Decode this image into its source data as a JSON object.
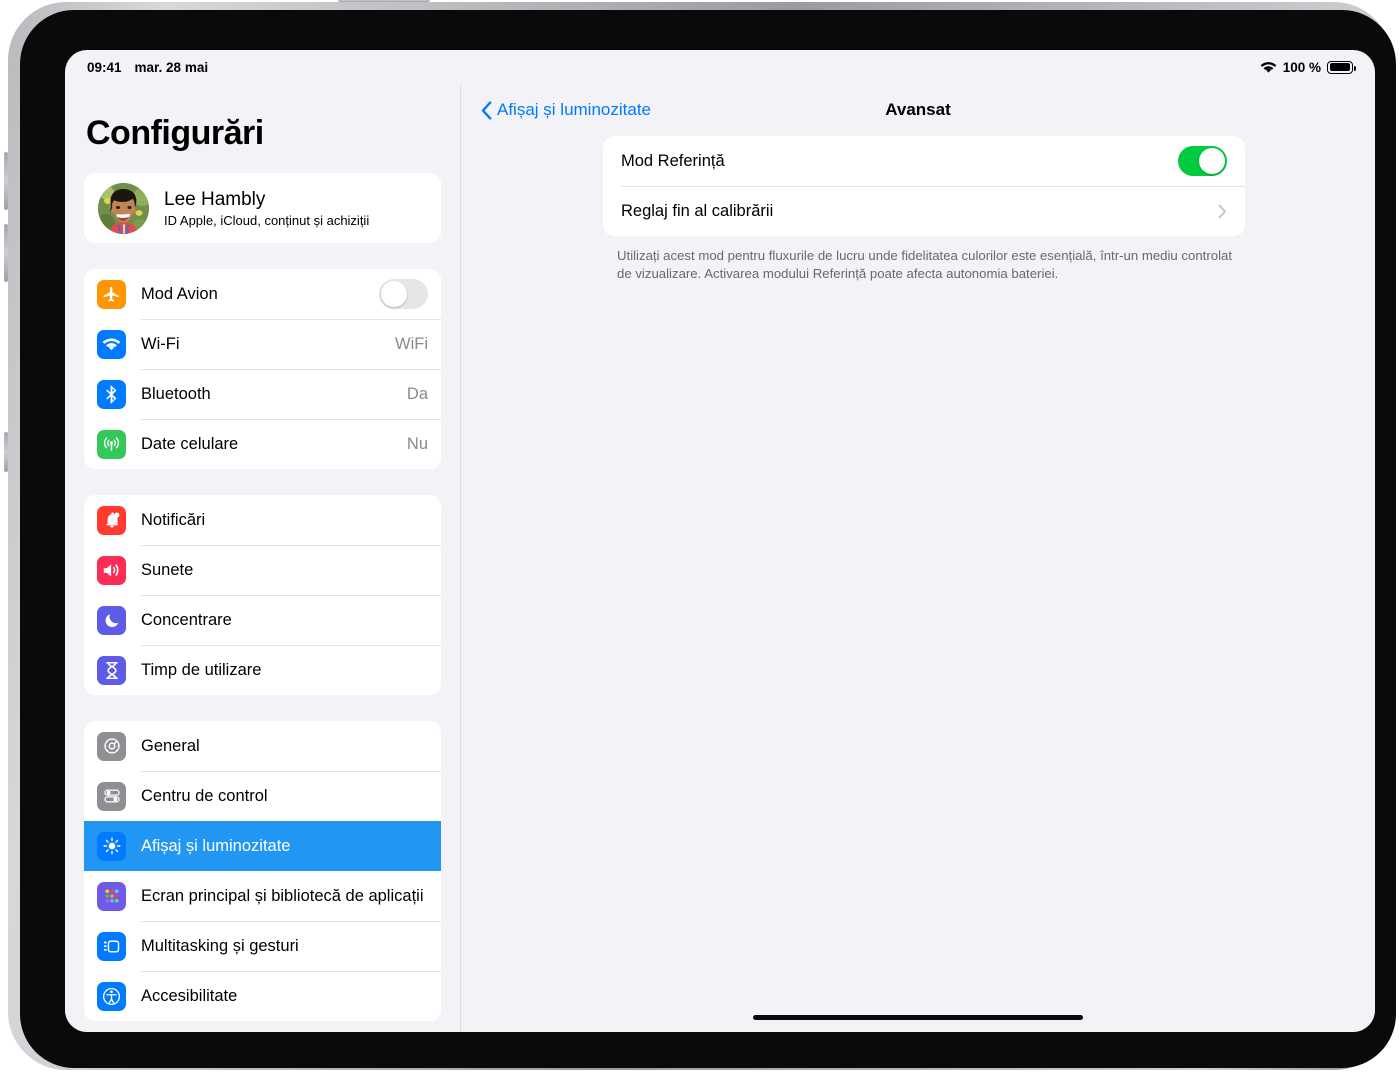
{
  "status_bar": {
    "time": "09:41",
    "date": "mar. 28 mai",
    "wifi_icon": "wifi-icon",
    "battery_percent": "100 %",
    "battery_icon": "battery-full-icon"
  },
  "sidebar": {
    "title": "Configurări",
    "account": {
      "name": "Lee Hambly",
      "subtitle": "ID Apple, iCloud, conținut și achiziții",
      "avatar_icon": "user-photo-avatar"
    },
    "groups": [
      {
        "items": [
          {
            "label": "Mod Avion",
            "icon": "airplane-icon",
            "icon_color": "#ff9500",
            "control": "toggle",
            "toggle_on": false
          },
          {
            "label": "Wi-Fi",
            "icon": "wifi-icon",
            "icon_color": "#007aff",
            "control": "value",
            "value": "WiFi"
          },
          {
            "label": "Bluetooth",
            "icon": "bluetooth-icon",
            "icon_color": "#007aff",
            "control": "value",
            "value": "Da"
          },
          {
            "label": "Date celulare",
            "icon": "cellular-antenna-icon",
            "icon_color": "#34c759",
            "control": "value",
            "value": "Nu"
          }
        ]
      },
      {
        "items": [
          {
            "label": "Notificări",
            "icon": "bell-icon",
            "icon_color": "#ff3b30",
            "control": "none"
          },
          {
            "label": "Sunete",
            "icon": "speaker-icon",
            "icon_color": "#fc2d55",
            "control": "none"
          },
          {
            "label": "Concentrare",
            "icon": "moon-icon",
            "icon_color": "#5e5ce6",
            "control": "none"
          },
          {
            "label": "Timp de utilizare",
            "icon": "hourglass-icon",
            "icon_color": "#5e5ce6",
            "control": "none"
          }
        ]
      },
      {
        "items": [
          {
            "label": "General",
            "icon": "gear-icon",
            "icon_color": "#8e8e93",
            "control": "none",
            "selected": false
          },
          {
            "label": "Centru de control",
            "icon": "control-center-icon",
            "icon_color": "#8e8e93",
            "control": "none",
            "selected": false
          },
          {
            "label": "Afișaj și luminozitate",
            "icon": "brightness-sun-icon",
            "icon_color": "#007aff",
            "control": "none",
            "selected": true
          },
          {
            "label": "Ecran principal și bibliotecă de aplicații",
            "icon": "app-grid-icon",
            "icon_color": "#6e5ce6",
            "control": "none",
            "selected": false
          },
          {
            "label": "Multitasking și gesturi",
            "icon": "multitasking-icon",
            "icon_color": "#007aff",
            "control": "none",
            "selected": false
          },
          {
            "label": "Accesibilitate",
            "icon": "accessibility-icon",
            "icon_color": "#007aff",
            "control": "none",
            "selected": false
          }
        ]
      }
    ]
  },
  "content": {
    "back_label": "Afișaj și luminozitate",
    "back_icon": "chevron-left-icon",
    "title": "Avansat",
    "rows": [
      {
        "label": "Mod Referință",
        "control": "toggle",
        "toggle_on": true
      },
      {
        "label": "Reglaj fin al calibrării",
        "control": "chevron",
        "chevron_icon": "chevron-right-icon"
      }
    ],
    "footer": "Utilizați acest mod pentru fluxurile de lucru unde fidelitatea culorilor este esențială, într-un mediu controlat de vizualizare. Activarea modului Referință poate afecta autonomia bateriei.",
    "home_indicator": "home-indicator"
  },
  "colors": {
    "accent_blue": "#007aff",
    "selected_row_blue": "#2196f3",
    "toggle_on_green": "#00cc3d",
    "background": "#f2f2f7"
  }
}
